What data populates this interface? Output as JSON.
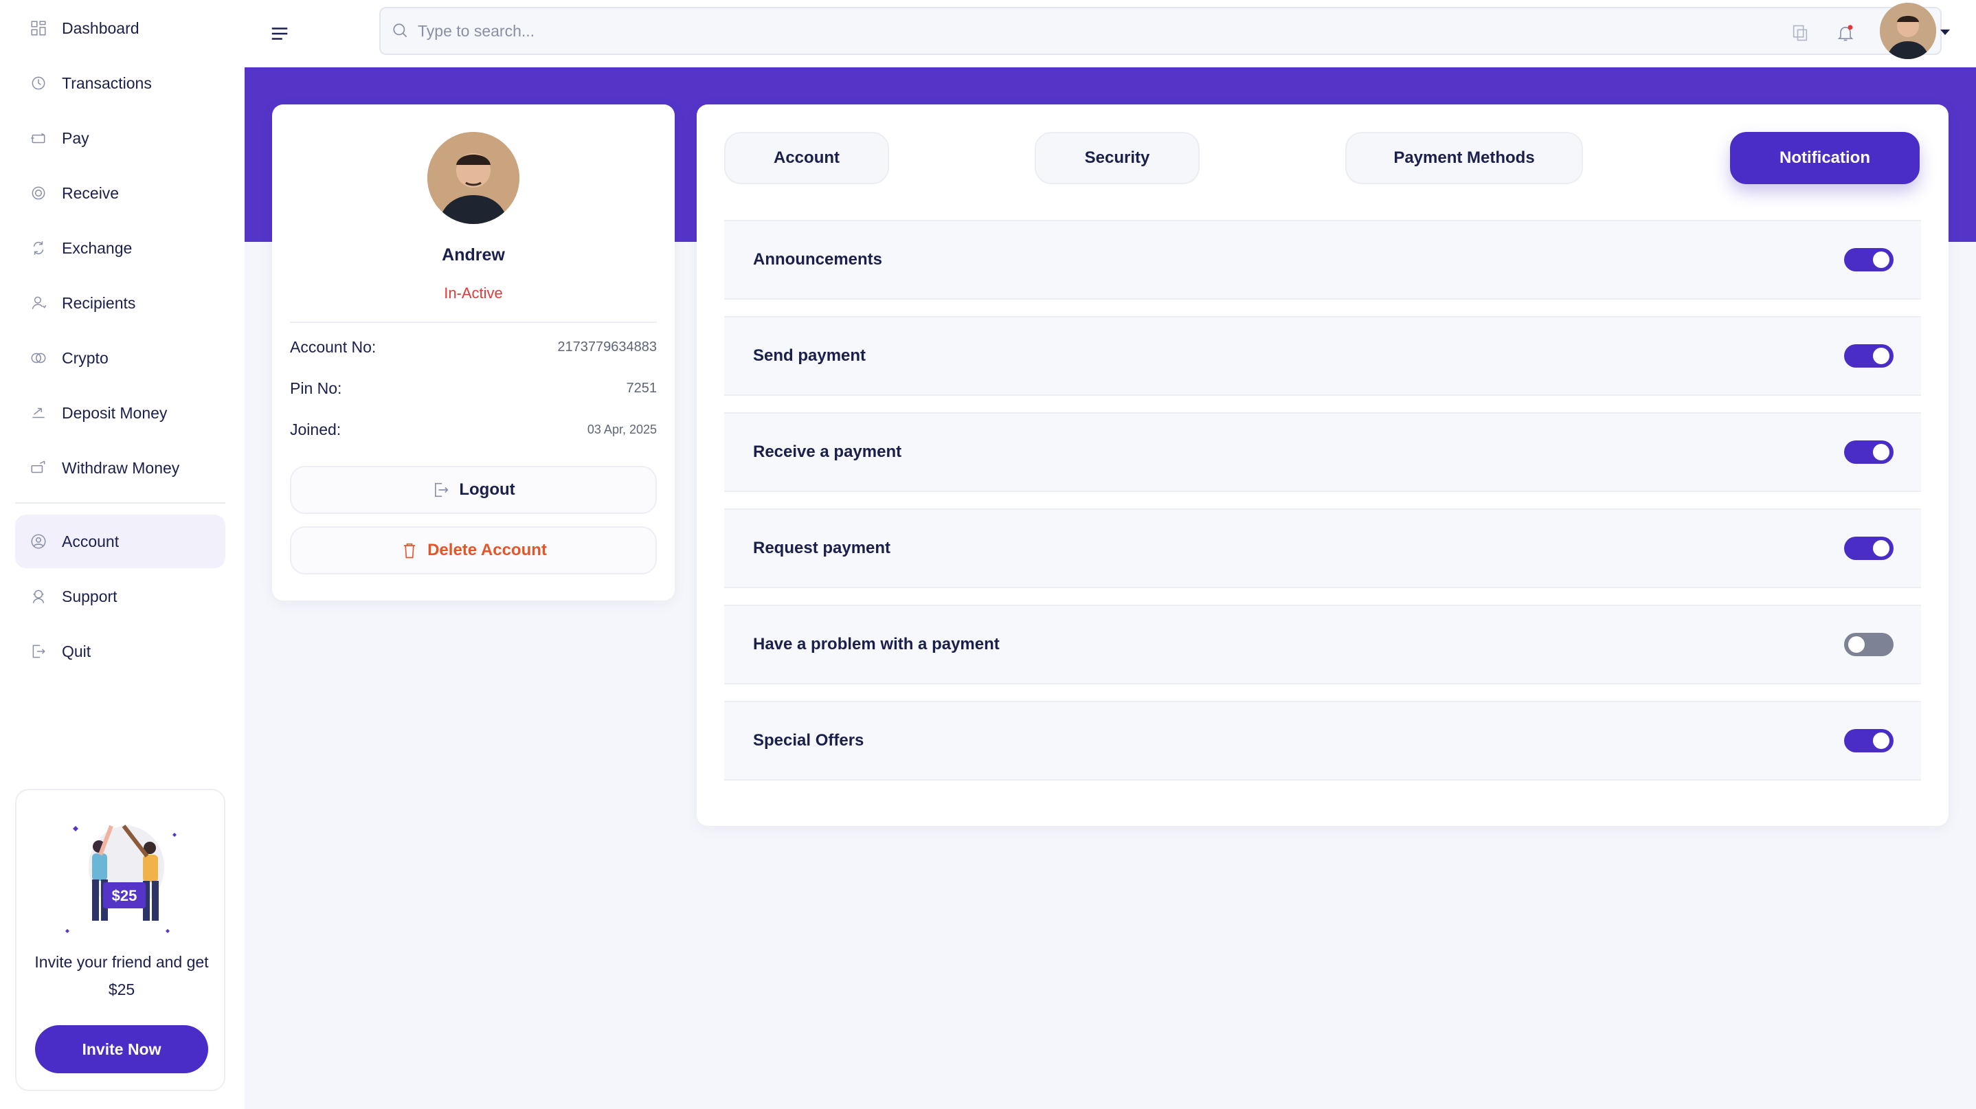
{
  "sidebar": {
    "items": [
      {
        "label": "Dashboard",
        "icon": "dashboard-icon"
      },
      {
        "label": "Transactions",
        "icon": "history-icon"
      },
      {
        "label": "Pay",
        "icon": "pay-icon"
      },
      {
        "label": "Receive",
        "icon": "receive-icon"
      },
      {
        "label": "Exchange",
        "icon": "exchange-icon"
      },
      {
        "label": "Recipients",
        "icon": "user-icon"
      },
      {
        "label": "Crypto",
        "icon": "crypto-icon"
      },
      {
        "label": "Deposit Money",
        "icon": "deposit-icon"
      },
      {
        "label": "Withdraw Money",
        "icon": "withdraw-icon"
      },
      {
        "label": "Account",
        "icon": "account-icon"
      },
      {
        "label": "Support",
        "icon": "support-icon"
      },
      {
        "label": "Quit",
        "icon": "quit-icon"
      }
    ],
    "active_item": "Account",
    "invite": {
      "amount": "$25",
      "text": "Invite your friend and get $25",
      "button": "Invite Now"
    }
  },
  "header": {
    "search_placeholder": "Type to search..."
  },
  "profile": {
    "name": "Andrew",
    "status": "In-Active",
    "fields": [
      {
        "label": "Account No:",
        "value": "2173779634883"
      },
      {
        "label": "Pin No:",
        "value": "7251"
      },
      {
        "label": "Joined:",
        "value": "03 Apr, 2025"
      }
    ],
    "logout_label": "Logout",
    "delete_label": "Delete Account"
  },
  "settings": {
    "tabs": [
      {
        "label": "Account"
      },
      {
        "label": "Security"
      },
      {
        "label": "Payment Methods"
      },
      {
        "label": "Notification"
      }
    ],
    "active_tab": "Notification",
    "notifications": [
      {
        "label": "Announcements",
        "enabled": true
      },
      {
        "label": "Send payment",
        "enabled": true
      },
      {
        "label": "Receive a payment",
        "enabled": true
      },
      {
        "label": "Request payment",
        "enabled": true
      },
      {
        "label": "Have a problem with a payment",
        "enabled": false
      },
      {
        "label": "Special Offers",
        "enabled": true
      }
    ]
  },
  "colors": {
    "accent": "#4a2dc6",
    "banner": "#5535c8",
    "status_inactive": "#e03a3a",
    "delete": "#e4552a"
  }
}
